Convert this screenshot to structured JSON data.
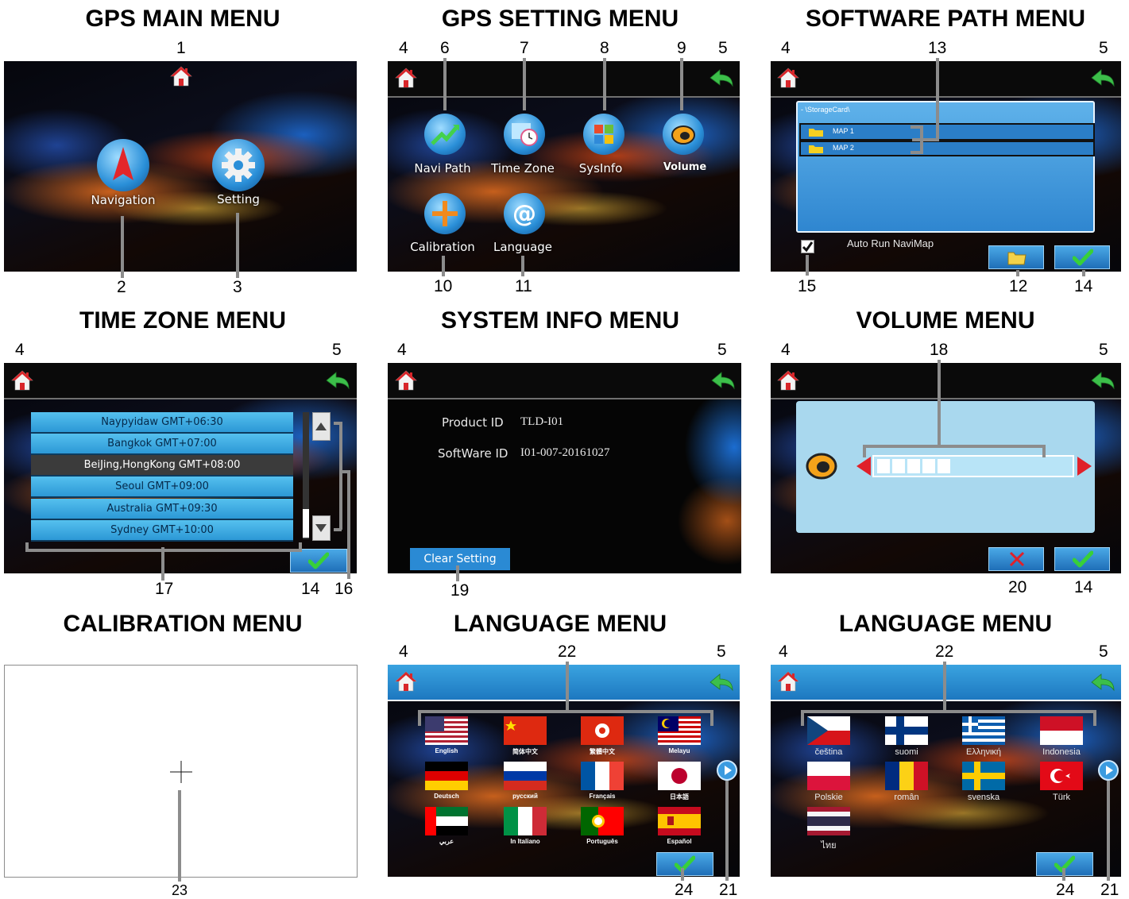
{
  "titles": {
    "main": "GPS MAIN MENU",
    "setting": "GPS SETTING MENU",
    "path": "SOFTWARE PATH MENU",
    "timezone": "TIME ZONE MENU",
    "sysinfo": "SYSTEM INFO MENU",
    "volume": "VOLUME MENU",
    "calibration": "CALIBRATION MENU",
    "language1": "LANGUAGE MENU",
    "language2": "LANGUAGE MENU"
  },
  "main_menu": {
    "navigation": "Navigation",
    "setting": "Setting"
  },
  "setting_menu": {
    "navi_path": "Navi Path",
    "time_zone": "Time Zone",
    "sysinfo": "SysInfo",
    "volume": "Volume",
    "calibration": "Calibration",
    "language": "Language"
  },
  "path_menu": {
    "path": "- \\StorageCard\\",
    "items": [
      "MAP 1",
      "MAP 2"
    ],
    "auto_run": "Auto Run NaviMap",
    "auto_run_checked": true
  },
  "timezone_menu": {
    "zones": [
      "Naypyidaw GMT+06:30",
      "Bangkok GMT+07:00",
      "BeiJing,HongKong GMT+08:00",
      "Seoul GMT+09:00",
      "Australia GMT+09:30",
      "Sydney GMT+10:00"
    ],
    "selected_index": 2
  },
  "sysinfo_menu": {
    "product_id_label": "Product ID",
    "product_id": "TLD-I01",
    "software_id_label": "SoftWare ID",
    "software_id": "I01-007-20161027",
    "clear_setting": "Clear Setting"
  },
  "volume_menu": {
    "level": 5,
    "max": 12
  },
  "language_menu1": [
    "English",
    "简体中文",
    "繁體中文",
    "Melayu",
    "Deutsch",
    "русский",
    "Français",
    "日本語",
    "عربي",
    "In Italiano",
    "Português",
    "Español"
  ],
  "language_menu2": [
    "čeština",
    "suomi",
    "Ελληνική",
    "Indonesia",
    "Polskie",
    "român",
    "svenska",
    "Türk",
    "ไทย"
  ],
  "callouts": {
    "n1": "1",
    "n2": "2",
    "n3": "3",
    "n4": "4",
    "n5": "5",
    "n6": "6",
    "n7": "7",
    "n8": "8",
    "n9": "9",
    "n10": "10",
    "n11": "11",
    "n12": "12",
    "n13": "13",
    "n14": "14",
    "n15": "15",
    "n16": "16",
    "n17": "17",
    "n18": "18",
    "n19": "19",
    "n20": "20",
    "n21": "21",
    "n22": "22",
    "n23": "23",
    "n24": "24"
  },
  "colors": {
    "screen_blue": "#2c98d6",
    "panel_light_blue": "#a9d8ee",
    "volume_arrow": "#e0202a",
    "ok_green": "#3cc23c",
    "leader_gray": "#8c8c8c"
  }
}
